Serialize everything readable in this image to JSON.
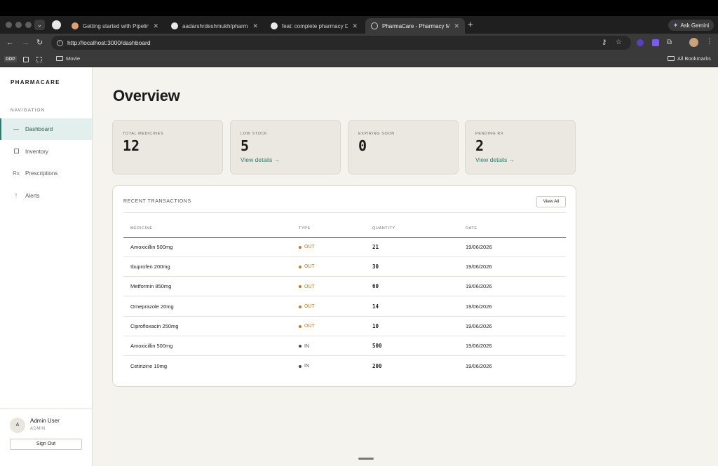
{
  "browser": {
    "tabs": [
      {
        "title": "Getting started with Pipeline",
        "icon": "pipeline-icon"
      },
      {
        "title": "aadarshrdeshmukh/pharmacy",
        "icon": "github-icon"
      },
      {
        "title": "feat: complete pharmacy Dev",
        "icon": "github-icon"
      },
      {
        "title": "PharmaCare - Pharmacy Man",
        "icon": "globe-icon",
        "active": true
      }
    ],
    "new_tab": "+",
    "gemini_label": "Ask Gemini",
    "url": "http://localhost:3000/dashboard",
    "bookmarks": {
      "ddp": "DDP",
      "movie": "Movie",
      "all_bookmarks": "All Bookmarks"
    }
  },
  "app": {
    "brand": "PHARMACARE",
    "nav_label": "NAVIGATION",
    "nav": [
      {
        "icon_glyph": "—",
        "label": "Dashboard",
        "active": true
      },
      {
        "icon_glyph": "",
        "label": "Inventory"
      },
      {
        "icon_glyph": "Rx",
        "label": "Prescriptions"
      },
      {
        "icon_glyph": "!",
        "label": "Alerts"
      }
    ],
    "user": {
      "initial": "A",
      "name": "Admin User",
      "role": "ADMIN",
      "sign_out": "Sign Out"
    }
  },
  "main": {
    "title": "Overview",
    "stats": [
      {
        "label": "TOTAL MEDICINES",
        "value": "12",
        "link": ""
      },
      {
        "label": "LOW STOCK",
        "value": "5",
        "link": "View details →"
      },
      {
        "label": "EXPIRING SOON",
        "value": "0",
        "link": ""
      },
      {
        "label": "PENDING RX",
        "value": "2",
        "link": "View details →"
      }
    ],
    "transactions": {
      "title": "RECENT TRANSACTIONS",
      "view_all": "View All",
      "columns": [
        "MEDICINE",
        "TYPE",
        "QUANTITY",
        "DATE"
      ],
      "rows": [
        {
          "medicine": "Amoxicillin 500mg",
          "type": "OUT",
          "quantity": "21",
          "date": "19/06/2026"
        },
        {
          "medicine": "Ibuprofen 200mg",
          "type": "OUT",
          "quantity": "30",
          "date": "19/06/2026"
        },
        {
          "medicine": "Metformin 850mg",
          "type": "OUT",
          "quantity": "60",
          "date": "19/06/2026"
        },
        {
          "medicine": "Omeprazole 20mg",
          "type": "OUT",
          "quantity": "14",
          "date": "19/06/2026"
        },
        {
          "medicine": "Ciprofloxacin 250mg",
          "type": "OUT",
          "quantity": "10",
          "date": "19/06/2026"
        },
        {
          "medicine": "Amoxicillin 500mg",
          "type": "IN",
          "quantity": "500",
          "date": "19/06/2026"
        },
        {
          "medicine": "Cetirizine 10mg",
          "type": "IN",
          "quantity": "200",
          "date": "19/06/2026"
        }
      ]
    }
  },
  "colors": {
    "accent": "#2f7a6f",
    "out": "#c07a2c",
    "background": "#f4f3ee",
    "stat_card": "#ebe8e1"
  }
}
